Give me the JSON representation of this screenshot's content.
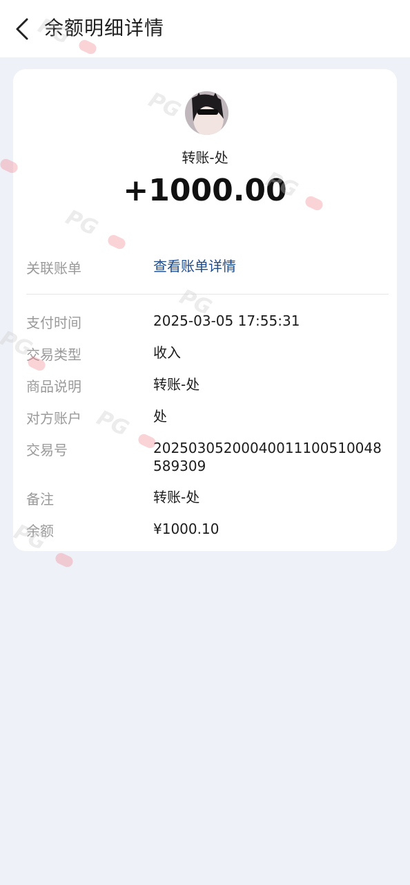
{
  "header": {
    "title": "余额明细详情",
    "back_icon": "chevron-left-icon"
  },
  "summary": {
    "counterparty": "转账-处",
    "amount": "+1000.00"
  },
  "linked_bill": {
    "label": "关联账单",
    "link_text": "查看账单详情"
  },
  "details": [
    {
      "label": "支付时间",
      "value": "2025-03-05 17:55:31"
    },
    {
      "label": "交易类型",
      "value": "收入"
    },
    {
      "label": "商品说明",
      "value": "转账-处"
    },
    {
      "label": "对方账户",
      "value": "处"
    },
    {
      "label": "交易号",
      "value": "2025030520004001110051004858​9309"
    },
    {
      "label": "备注",
      "value": "转账-处"
    },
    {
      "label": "余额",
      "value": "¥1000.10"
    }
  ],
  "watermark": "PG",
  "colors": {
    "background": "#eef1f7",
    "card": "#ffffff",
    "link": "#1e4b8c",
    "label": "#9a9a9a"
  }
}
